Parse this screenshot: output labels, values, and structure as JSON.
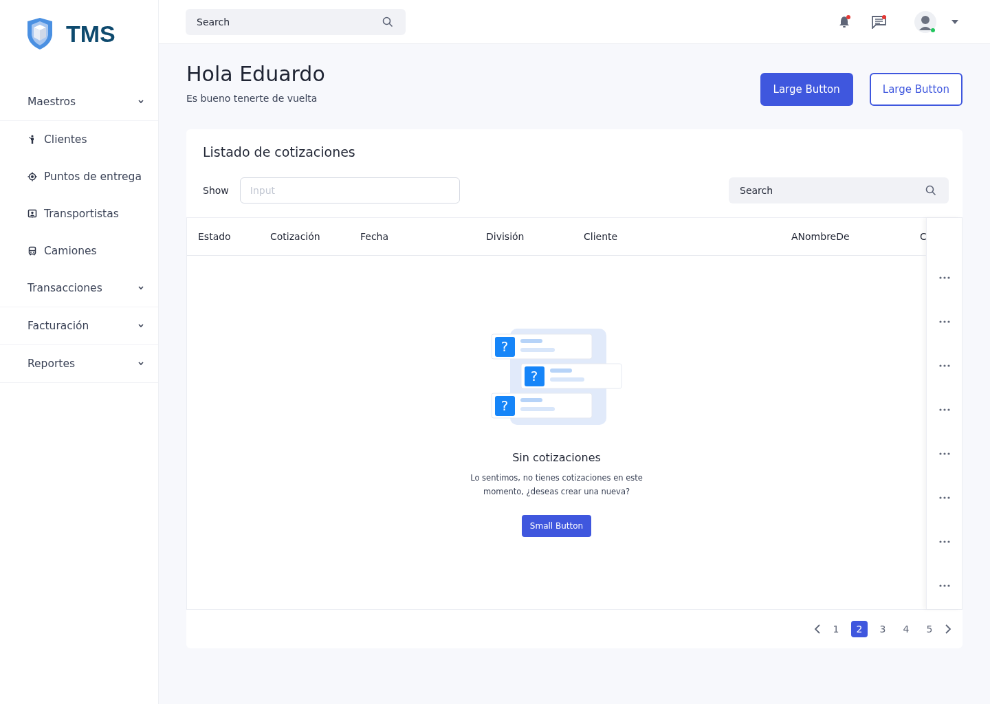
{
  "logo": {
    "text": "TMS"
  },
  "sidebar": {
    "items": [
      {
        "kind": "group",
        "label": "Maestros"
      },
      {
        "kind": "link",
        "label": "Clientes"
      },
      {
        "kind": "link",
        "label": "Puntos de entrega"
      },
      {
        "kind": "link",
        "label": "Transportistas"
      },
      {
        "kind": "link",
        "label": "Camiones"
      },
      {
        "kind": "group",
        "label": "Transacciones"
      },
      {
        "kind": "group",
        "label": "Facturación"
      },
      {
        "kind": "group",
        "label": "Reportes"
      }
    ]
  },
  "topbar": {
    "search": {
      "placeholder": "Search"
    },
    "notifications": {
      "unread": true
    },
    "messages": {
      "unread": true
    },
    "user": {
      "online": true
    }
  },
  "header": {
    "title": "Hola Eduardo",
    "subtitle": "Es bueno tenerte de vuelta",
    "buttons": [
      {
        "kind": "primary",
        "label": "Large Button"
      },
      {
        "kind": "outline",
        "label": "Large Button"
      }
    ]
  },
  "card": {
    "title": "Listado de cotizaciones",
    "show_label": "Show",
    "input": {
      "placeholder": "Input"
    },
    "search": {
      "placeholder": "Search"
    },
    "table": {
      "columns": [
        "Estado",
        "Cotización",
        "Fecha",
        "División",
        "Cliente",
        "ANombreDe",
        "C"
      ]
    },
    "empty": {
      "title": "Sin cotizaciones",
      "message": "Lo sentimos, no tienes cotizaciones en este momento, ¿deseas crear una nueva?",
      "button": "Small Button",
      "marks": [
        "?",
        "?",
        "?"
      ]
    },
    "pagination": {
      "pages": [
        {
          "label": "1",
          "selected": false
        },
        {
          "label": "2",
          "selected": true
        },
        {
          "label": "3",
          "selected": false
        },
        {
          "label": "4",
          "selected": false
        },
        {
          "label": "5",
          "selected": false
        }
      ]
    }
  }
}
